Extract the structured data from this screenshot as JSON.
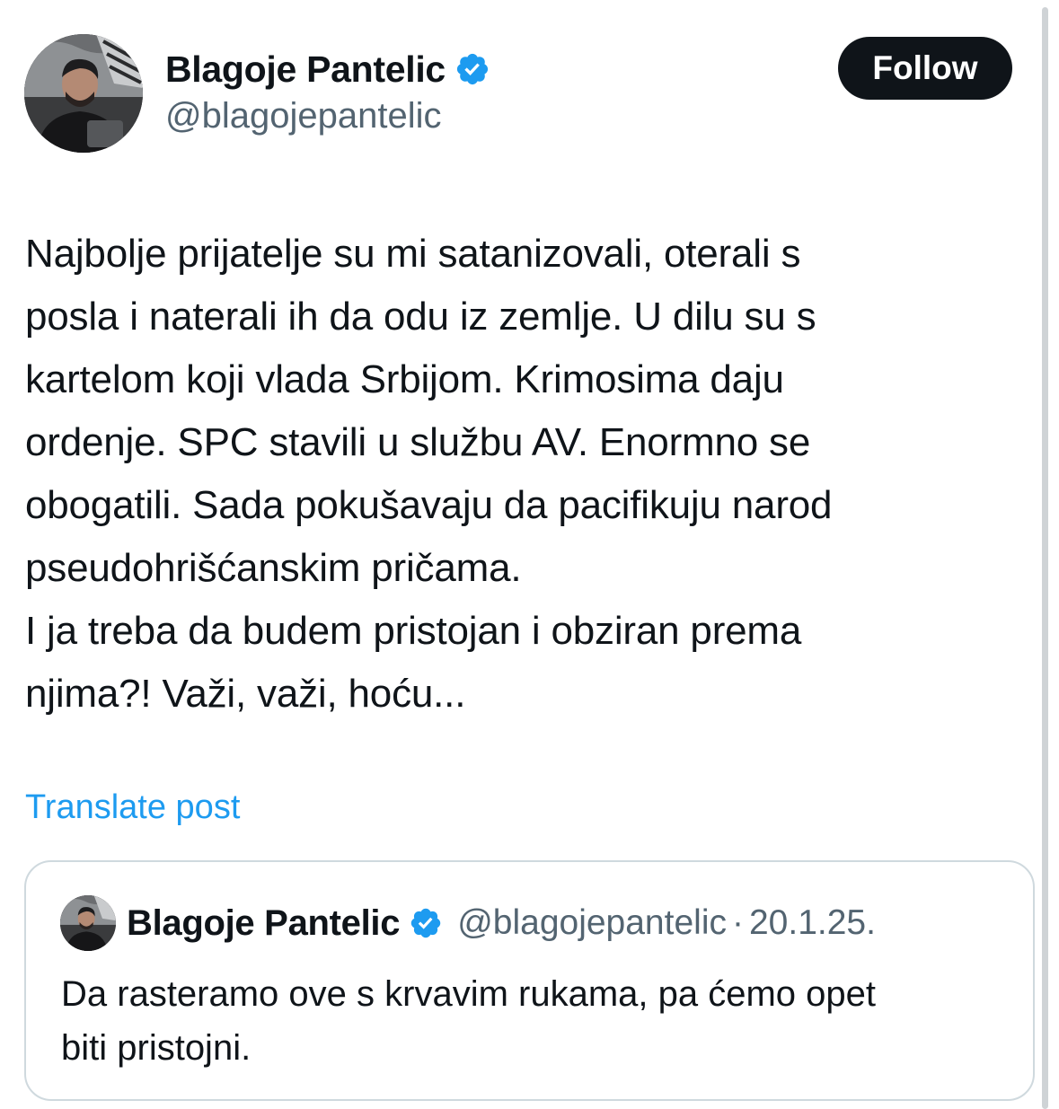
{
  "author": {
    "display_name": "Blagoje Pantelic",
    "handle": "@blagojepantelic",
    "verified_icon": "verified-badge-icon",
    "avatar_icon": "profile-photo"
  },
  "follow_label": "Follow",
  "post": {
    "lines": [
      "Najbolje prijatelje su mi satanizovali, oterali s",
      "posla i naterali ih da odu iz zemlje. U dilu su s",
      "kartelom koji vlada Srbijom. Krimosima daju",
      "ordenje. SPC stavili u službu AV. Enormno se",
      "obogatili. Sada pokušavaju da pacifikuju narod",
      "pseudohrišćanskim pričama.",
      "I ja treba da budem pristojan i obziran prema",
      "njima?! Važi, važi, hoću..."
    ]
  },
  "translate_label": "Translate post",
  "quoted_post": {
    "display_name": "Blagoje Pantelic",
    "handle": "@blagojepantelic",
    "separator": "·",
    "date": "20.1.25.",
    "lines": [
      "Da rasteramo ove s krvavim rukama, pa ćemo opet",
      "biti pristojni."
    ]
  },
  "colors": {
    "text": "#0f1419",
    "secondary": "#536471",
    "link": "#1d9bf0",
    "verified": "#1d9bf0",
    "border": "#cfd9de",
    "button_bg": "#0f1419"
  }
}
